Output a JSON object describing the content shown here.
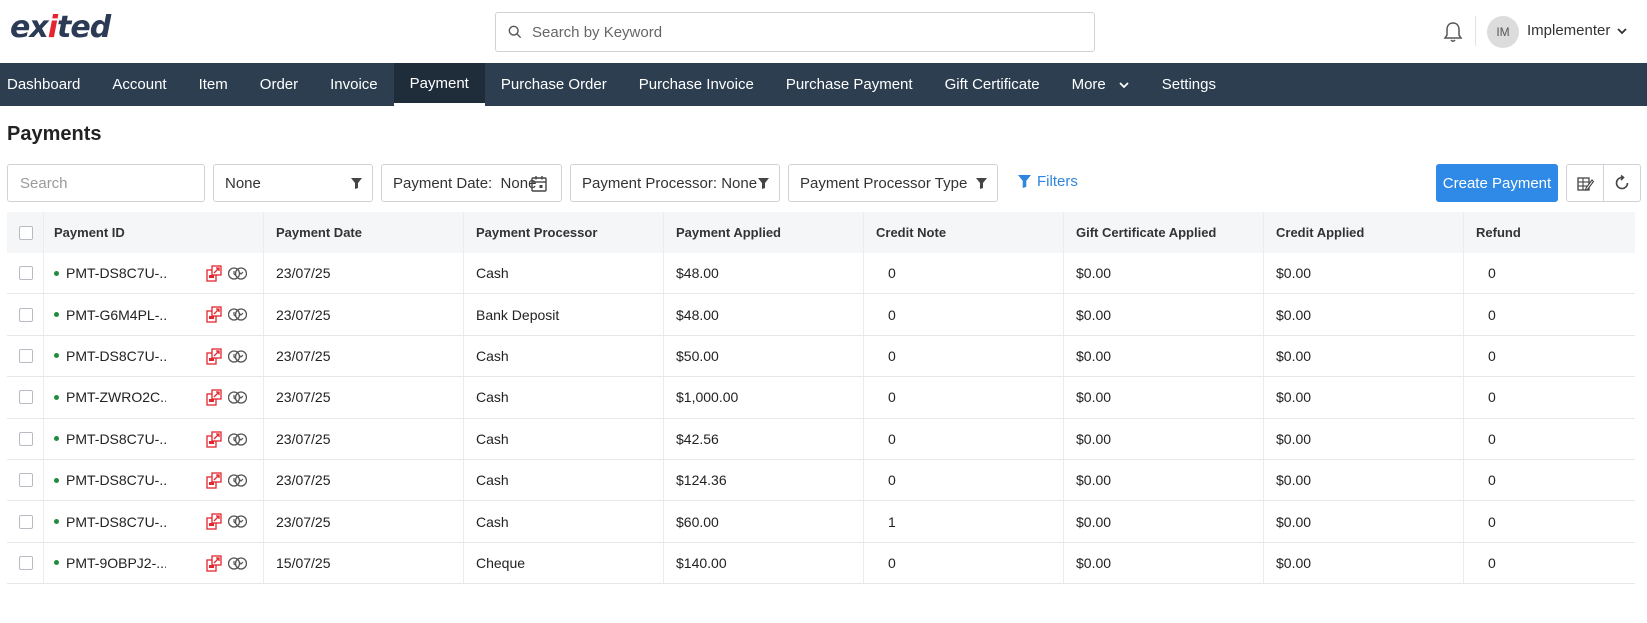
{
  "header": {
    "logo_text_a": "ex",
    "logo_text_b": "i",
    "logo_text_c": "ted",
    "search_placeholder": "Search by Keyword",
    "user_initials": "IM",
    "user_name": "Implementer"
  },
  "nav": {
    "items": [
      "Dashboard",
      "Account",
      "Item",
      "Order",
      "Invoice",
      "Payment",
      "Purchase Order",
      "Purchase Invoice",
      "Purchase Payment",
      "Gift Certificate",
      "More",
      "Settings"
    ],
    "active": "Payment"
  },
  "page": {
    "title": "Payments",
    "search_placeholder": "Search",
    "filter_none": "None",
    "payment_date_label": "Payment Date:  None",
    "payment_processor_label": "Payment Processor: None",
    "payment_processor_type_label": "Payment Processor Type",
    "filters_label": "Filters",
    "create_button": "Create Payment"
  },
  "table": {
    "headers": [
      "Payment ID",
      "Payment Date",
      "Payment Processor",
      "Payment Applied",
      "Credit Note",
      "Gift Certificate Applied",
      "Credit Applied",
      "Refund"
    ],
    "rows": [
      {
        "id": "PMT-DS8C7U-...",
        "date": "23/07/25",
        "processor": "Cash",
        "applied": "$48.00",
        "credit_note": "0",
        "gift": "$0.00",
        "credit_applied": "$0.00",
        "refund": "0"
      },
      {
        "id": "PMT-G6M4PL-...",
        "date": "23/07/25",
        "processor": "Bank Deposit",
        "applied": "$48.00",
        "credit_note": "0",
        "gift": "$0.00",
        "credit_applied": "$0.00",
        "refund": "0"
      },
      {
        "id": "PMT-DS8C7U-...",
        "date": "23/07/25",
        "processor": "Cash",
        "applied": "$50.00",
        "credit_note": "0",
        "gift": "$0.00",
        "credit_applied": "$0.00",
        "refund": "0"
      },
      {
        "id": "PMT-ZWRO2C...",
        "date": "23/07/25",
        "processor": "Cash",
        "applied": "$1,000.00",
        "credit_note": "0",
        "gift": "$0.00",
        "credit_applied": "$0.00",
        "refund": "0"
      },
      {
        "id": "PMT-DS8C7U-...",
        "date": "23/07/25",
        "processor": "Cash",
        "applied": "$42.56",
        "credit_note": "0",
        "gift": "$0.00",
        "credit_applied": "$0.00",
        "refund": "0"
      },
      {
        "id": "PMT-DS8C7U-...",
        "date": "23/07/25",
        "processor": "Cash",
        "applied": "$124.36",
        "credit_note": "0",
        "gift": "$0.00",
        "credit_applied": "$0.00",
        "refund": "0"
      },
      {
        "id": "PMT-DS8C7U-...",
        "date": "23/07/25",
        "processor": "Cash",
        "applied": "$60.00",
        "credit_note": "1",
        "gift": "$0.00",
        "credit_applied": "$0.00",
        "refund": "0"
      },
      {
        "id": "PMT-9OBPJ2-...",
        "date": "15/07/25",
        "processor": "Cheque",
        "applied": "$140.00",
        "credit_note": "0",
        "gift": "$0.00",
        "credit_applied": "$0.00",
        "refund": "0"
      }
    ]
  },
  "colors": {
    "nav_bg": "#2c3e50",
    "accent_blue": "#2e8ae6",
    "logo_navy": "#2b3a55",
    "logo_red": "#e3262f",
    "status_green": "#1e8e3e"
  }
}
